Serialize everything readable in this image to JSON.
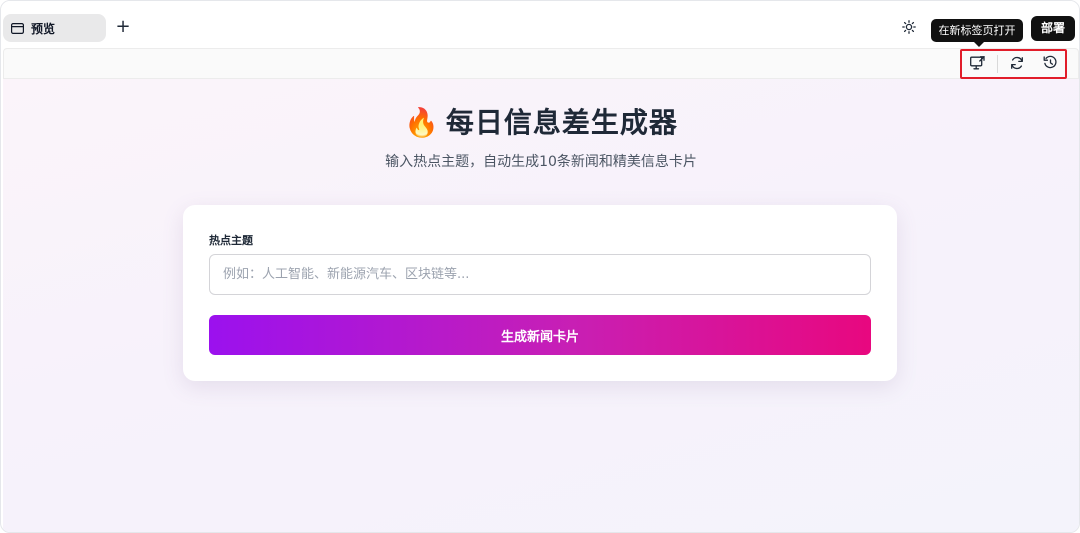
{
  "app": {
    "tab_label": "预览",
    "new_tab_symbol": "+",
    "tooltip_text": "在新标签页打开",
    "deploy_label": "部署",
    "highlight_color": "#e11d2a"
  },
  "toolbar": {
    "icons": [
      "open-in-new-tab-icon",
      "refresh-icon",
      "restart-icon"
    ]
  },
  "page": {
    "title_emoji": "🔥",
    "title": "每日信息差生成器",
    "subtitle": "输入热点主题，自动生成10条新闻和精美信息卡片",
    "form": {
      "topic_label": "热点主题",
      "topic_value": "",
      "topic_placeholder": "例如：人工智能、新能源汽车、区块链等...",
      "submit_label": "生成新闻卡片"
    },
    "button_gradient": [
      "#9b11ee",
      "#e8087f"
    ]
  }
}
